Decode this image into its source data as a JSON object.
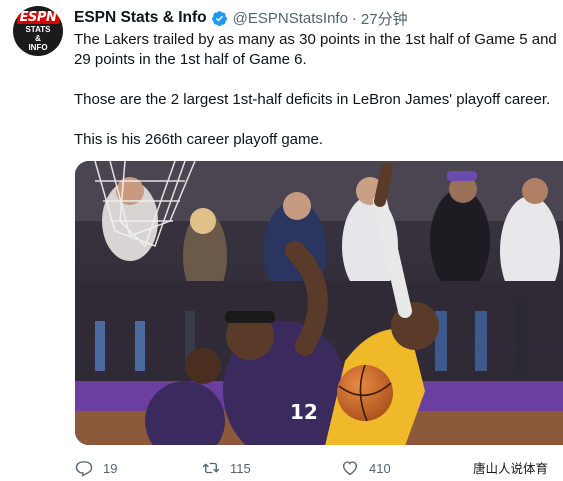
{
  "tweet": {
    "author": {
      "display_name": "ESPN Stats & Info",
      "handle": "@ESPNStatsInfo",
      "verified": true,
      "avatar": {
        "logo_text": "ESPN",
        "line1": "STATS",
        "line2": "&",
        "line3": "INFO"
      }
    },
    "separator": "·",
    "timestamp": "27分钟",
    "text": {
      "line1": "The Lakers trailed by as many as 30 points in the 1st half of Game 5 and",
      "line2": "29 points in the 1st half of Game 6.",
      "paragraph2": "Those are the 2 largest 1st-half deficits in LeBron James' playoff career.",
      "paragraph3": "This is his 266th career playoff game."
    },
    "media": {
      "type": "photo",
      "jersey_number": "12"
    },
    "actions": {
      "replies": "19",
      "retweets": "115",
      "likes": "410"
    },
    "watermark": "唐山人说体育",
    "colors": {
      "verified_blue": "#1d9bf0",
      "secondary_text": "#536471",
      "lakers_gold": "#f0b929",
      "suns_purple": "#3b2a5e"
    }
  }
}
